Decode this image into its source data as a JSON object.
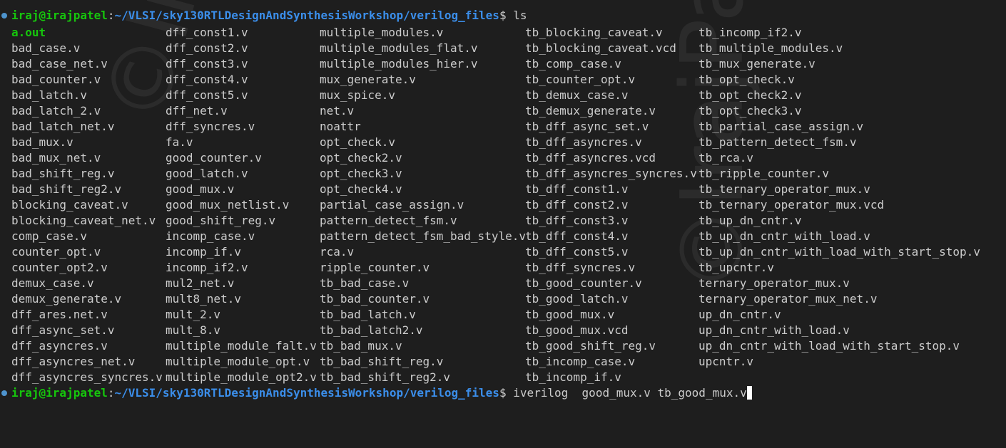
{
  "prompt": {
    "user_host": "iraj@irajpatel",
    "path": "~/VLSI/sky130RTLDesignAndSynthesisWorkshop/verilog_files",
    "symbol": "$"
  },
  "commands": {
    "first": "ls",
    "second": "iverilog  good_mux.v tb_good_mux.v"
  },
  "columns": [
    [
      "a.out",
      "bad_case.v",
      "bad_case_net.v",
      "bad_counter.v",
      "bad_latch.v",
      "bad_latch_2.v",
      "bad_latch_net.v",
      "bad_mux.v",
      "bad_mux_net.v",
      "bad_shift_reg.v",
      "bad_shift_reg2.v",
      "blocking_caveat.v",
      "blocking_caveat_net.v",
      "comp_case.v",
      "counter_opt.v",
      "counter_opt2.v",
      "demux_case.v",
      "demux_generate.v",
      "dff_ares.net.v",
      "dff_async_set.v",
      "dff_asyncres.v",
      "dff_asyncres_net.v",
      "dff_asyncres_syncres.v"
    ],
    [
      "dff_const1.v",
      "dff_const2.v",
      "dff_const3.v",
      "dff_const4.v",
      "dff_const5.v",
      "dff_net.v",
      "dff_syncres.v",
      "fa.v",
      "good_counter.v",
      "good_latch.v",
      "good_mux.v",
      "good_mux_netlist.v",
      "good_shift_reg.v",
      "incomp_case.v",
      "incomp_if.v",
      "incomp_if2.v",
      "mul2_net.v",
      "mult8_net.v",
      "mult_2.v",
      "mult_8.v",
      "multiple_module_falt.v",
      "multiple_module_opt.v",
      "multiple_module_opt2.v"
    ],
    [
      "multiple_modules.v",
      "multiple_modules_flat.v",
      "multiple_modules_hier.v",
      "mux_generate.v",
      "mux_spice.v",
      "net.v",
      "noattr",
      "opt_check.v",
      "opt_check2.v",
      "opt_check3.v",
      "opt_check4.v",
      "partial_case_assign.v",
      "pattern_detect_fsm.v",
      "pattern_detect_fsm_bad_style.v",
      "rca.v",
      "ripple_counter.v",
      "tb_bad_case.v",
      "tb_bad_counter.v",
      "tb_bad_latch.v",
      "tb_bad_latch2.v",
      "tb_bad_mux.v",
      "tb_bad_shift_reg.v",
      "tb_bad_shift_reg2.v"
    ],
    [
      "tb_blocking_caveat.v",
      "tb_blocking_caveat.vcd",
      "tb_comp_case.v",
      "tb_counter_opt.v",
      "tb_demux_case.v",
      "tb_demux_generate.v",
      "tb_dff_async_set.v",
      "tb_dff_asyncres.v",
      "tb_dff_asyncres.vcd",
      "tb_dff_asyncres_syncres.v",
      "tb_dff_const1.v",
      "tb_dff_const2.v",
      "tb_dff_const3.v",
      "tb_dff_const4.v",
      "tb_dff_const5.v",
      "tb_dff_syncres.v",
      "tb_good_counter.v",
      "tb_good_latch.v",
      "tb_good_mux.v",
      "tb_good_mux.vcd",
      "tb_good_shift_reg.v",
      "tb_incomp_case.v",
      "tb_incomp_if.v"
    ],
    [
      "tb_incomp_if2.v",
      "tb_multiple_modules.v",
      "tb_mux_generate.v",
      "tb_opt_check.v",
      "tb_opt_check2.v",
      "tb_opt_check3.v",
      "tb_partial_case_assign.v",
      "tb_pattern_detect_fsm.v",
      "tb_rca.v",
      "tb_ripple_counter.v",
      "tb_ternary_operator_mux.v",
      "tb_ternary_operator_mux.vcd",
      "tb_up_dn_cntr.v",
      "tb_up_dn_cntr_with_load.v",
      "tb_up_dn_cntr_with_load_with_start_stop.v",
      "tb_upcntr.v",
      "ternary_operator_mux.v",
      "ternary_operator_mux_net.v",
      "up_dn_cntr.v",
      "up_dn_cntr_with_load.v",
      "up_dn_cntr_with_load_with_start_stop.v",
      "upcntr.v",
      ""
    ]
  ],
  "executable_files": [
    "a.out"
  ],
  "watermark": "©IrajPatel",
  "colors": {
    "background": "#1e1e1e",
    "text": "#cccccc",
    "user_host": "#16c60c",
    "path": "#3b8eea",
    "executable": "#16c60c",
    "status_dot": "#4e94ce"
  }
}
